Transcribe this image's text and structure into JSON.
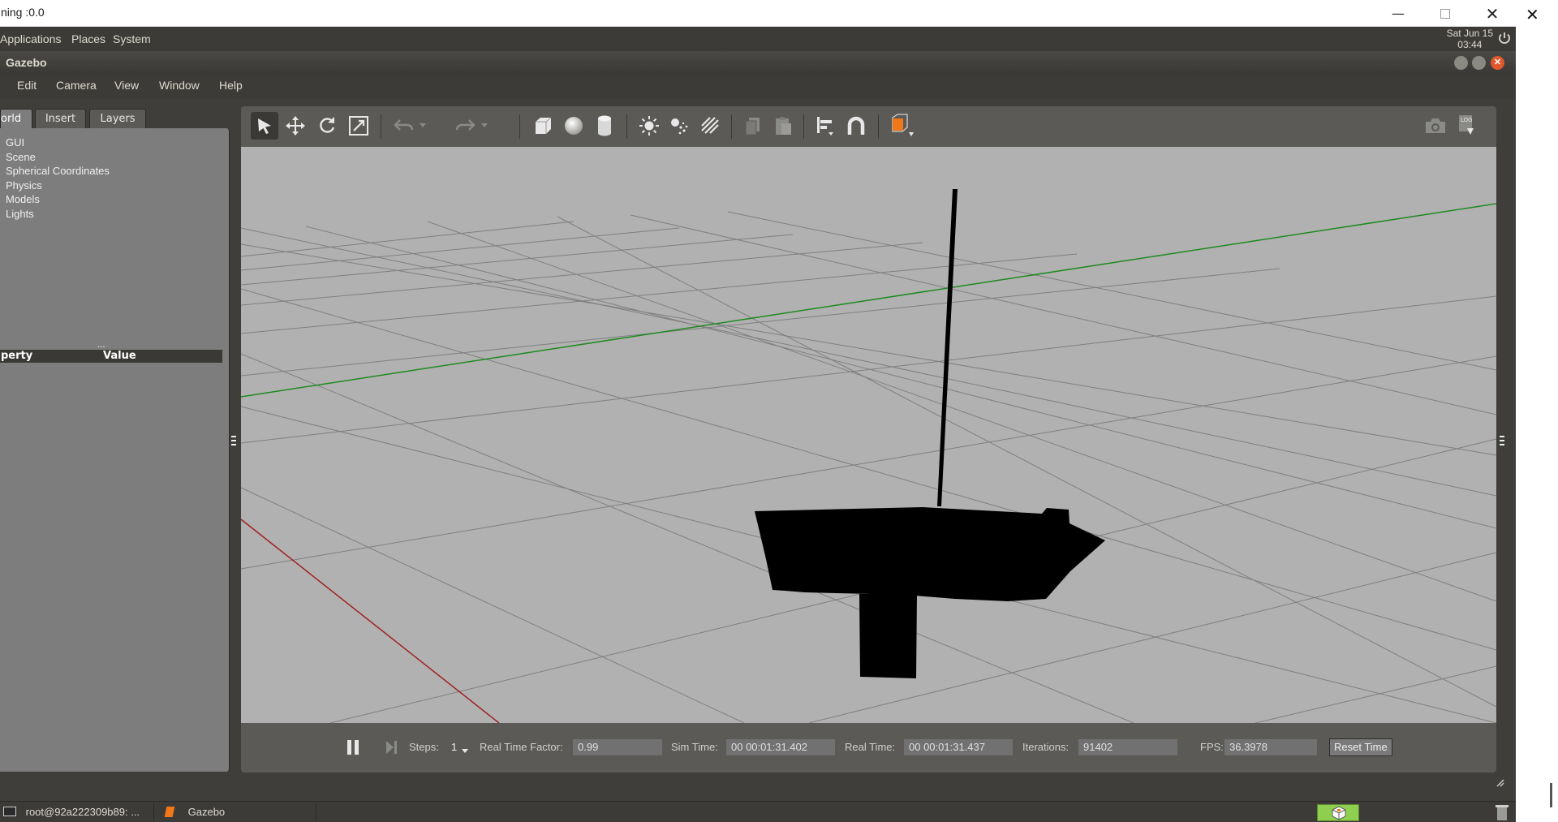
{
  "host_window": {
    "title": "ning :0.0"
  },
  "top_panel": {
    "menus": [
      "Applications",
      "Places",
      "System"
    ],
    "clock_line1": "Sat Jun 15",
    "clock_line2": "03:44"
  },
  "gazebo_window": {
    "title": "Gazebo",
    "menus": [
      "Edit",
      "Camera",
      "View",
      "Window",
      "Help"
    ]
  },
  "left_panel": {
    "tabs": [
      "orld",
      "Insert",
      "Layers"
    ],
    "tree_items": [
      "GUI",
      "Scene",
      "Spherical Coordinates",
      "Physics",
      "Models",
      "Lights"
    ],
    "splitter_grip": "...",
    "property_col": "perty",
    "value_col": "Value"
  },
  "bottom_bar": {
    "steps_label": "Steps:",
    "steps_value": "1",
    "rtf_label": "Real Time Factor:",
    "rtf_value": "0.99",
    "sim_time_label": "Sim Time:",
    "sim_time_value": "00 00:01:31.402",
    "real_time_label": "Real Time:",
    "real_time_value": "00 00:01:31.437",
    "iterations_label": "Iterations:",
    "iterations_value": "91402",
    "fps_label": "FPS:",
    "fps_value": "36.3978",
    "reset_label": "Reset Time"
  },
  "taskbar": {
    "terminal_task": "root@92a222309b89: ...",
    "gazebo_task": "Gazebo"
  },
  "colors": {
    "panel_bg": "#3c3b37",
    "viewport_bg": "#b1b1b1",
    "x_axis": "#a02020",
    "y_axis": "#1f8a1f",
    "model": "#000000",
    "accent_orange": "#f07818"
  }
}
